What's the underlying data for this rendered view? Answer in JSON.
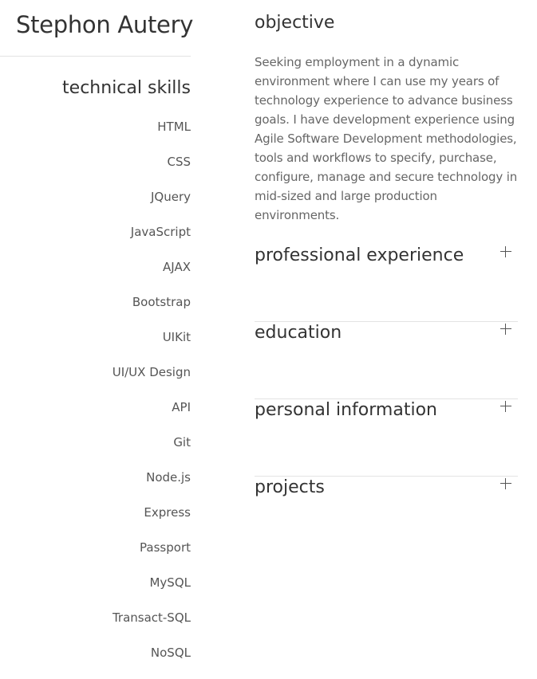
{
  "profile": {
    "name": "Stephon Autery"
  },
  "skills": {
    "heading": "technical skills",
    "items": [
      "HTML",
      "CSS",
      "JQuery",
      "JavaScript",
      "AJAX",
      "Bootstrap",
      "UIKit",
      "UI/UX Design",
      "API",
      "Git",
      "Node.js",
      "Express",
      "Passport",
      "MySQL",
      "Transact-SQL",
      "NoSQL"
    ]
  },
  "objective": {
    "heading": "objective",
    "text": "Seeking employment in a dynamic environment where I can use my years of technology experience to advance business goals. I have development experience using Agile Software Development methodologies, tools and workflows to specify, purchase, configure, manage and secure technology in mid-sized and large production environments."
  },
  "sections": [
    {
      "title": "professional experience",
      "icon": "plus-icon"
    },
    {
      "title": "education",
      "icon": "plus-icon"
    },
    {
      "title": "personal information",
      "icon": "plus-icon"
    },
    {
      "title": "projects",
      "icon": "plus-icon"
    }
  ]
}
